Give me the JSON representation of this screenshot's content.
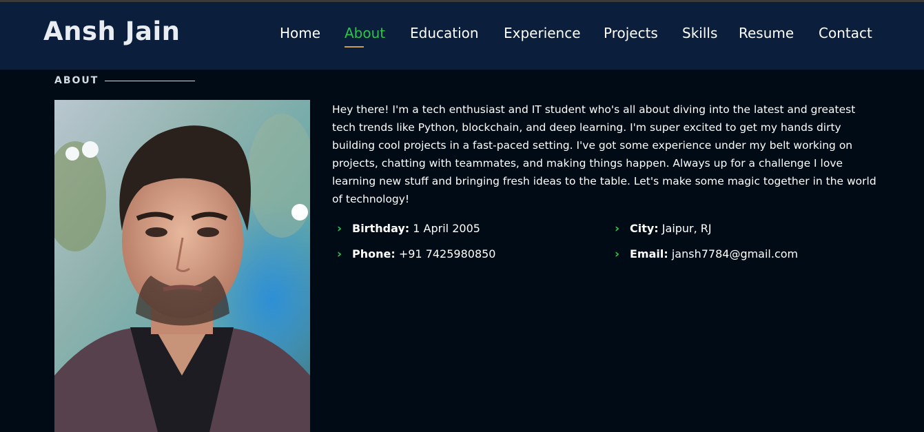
{
  "brand": "Ansh Jain",
  "nav": [
    {
      "label": "Home",
      "active": false
    },
    {
      "label": "About",
      "active": true
    },
    {
      "label": "Education",
      "active": false
    },
    {
      "label": "Experience",
      "active": false
    },
    {
      "label": "Projects",
      "active": false
    },
    {
      "label": "Skills",
      "active": false
    },
    {
      "label": "Resume",
      "active": false
    },
    {
      "label": "Contact",
      "active": false
    }
  ],
  "section": {
    "label": "ABOUT"
  },
  "bio": "Hey there! I'm a tech enthusiast and IT student who's all about diving into the latest and greatest tech trends like Python, blockchain, and deep learning. I'm super excited to get my hands dirty building cool projects in a fast-paced setting. I've got some experience under my belt working on projects, chatting with teammates, and making things happen. Always up for a challenge I love learning new stuff and bringing fresh ideas to the table. Let's make some magic together in the world of technology!",
  "info": {
    "birthday": {
      "key": "Birthday:",
      "value": " 1 April 2005"
    },
    "city": {
      "key": "City:",
      "value": " Jaipur, RJ"
    },
    "phone": {
      "key": "Phone:",
      "value": " +91 7425980850"
    },
    "email": {
      "key": "Email:",
      "value": " jansh7784@gmail.com"
    }
  },
  "colors": {
    "accent": "#2ec34a",
    "header_bg": "#0b1e3c",
    "page_bg": "#010b16",
    "underline": "#c9a14a"
  },
  "icons": {
    "bullet": "chevron-right-icon"
  }
}
